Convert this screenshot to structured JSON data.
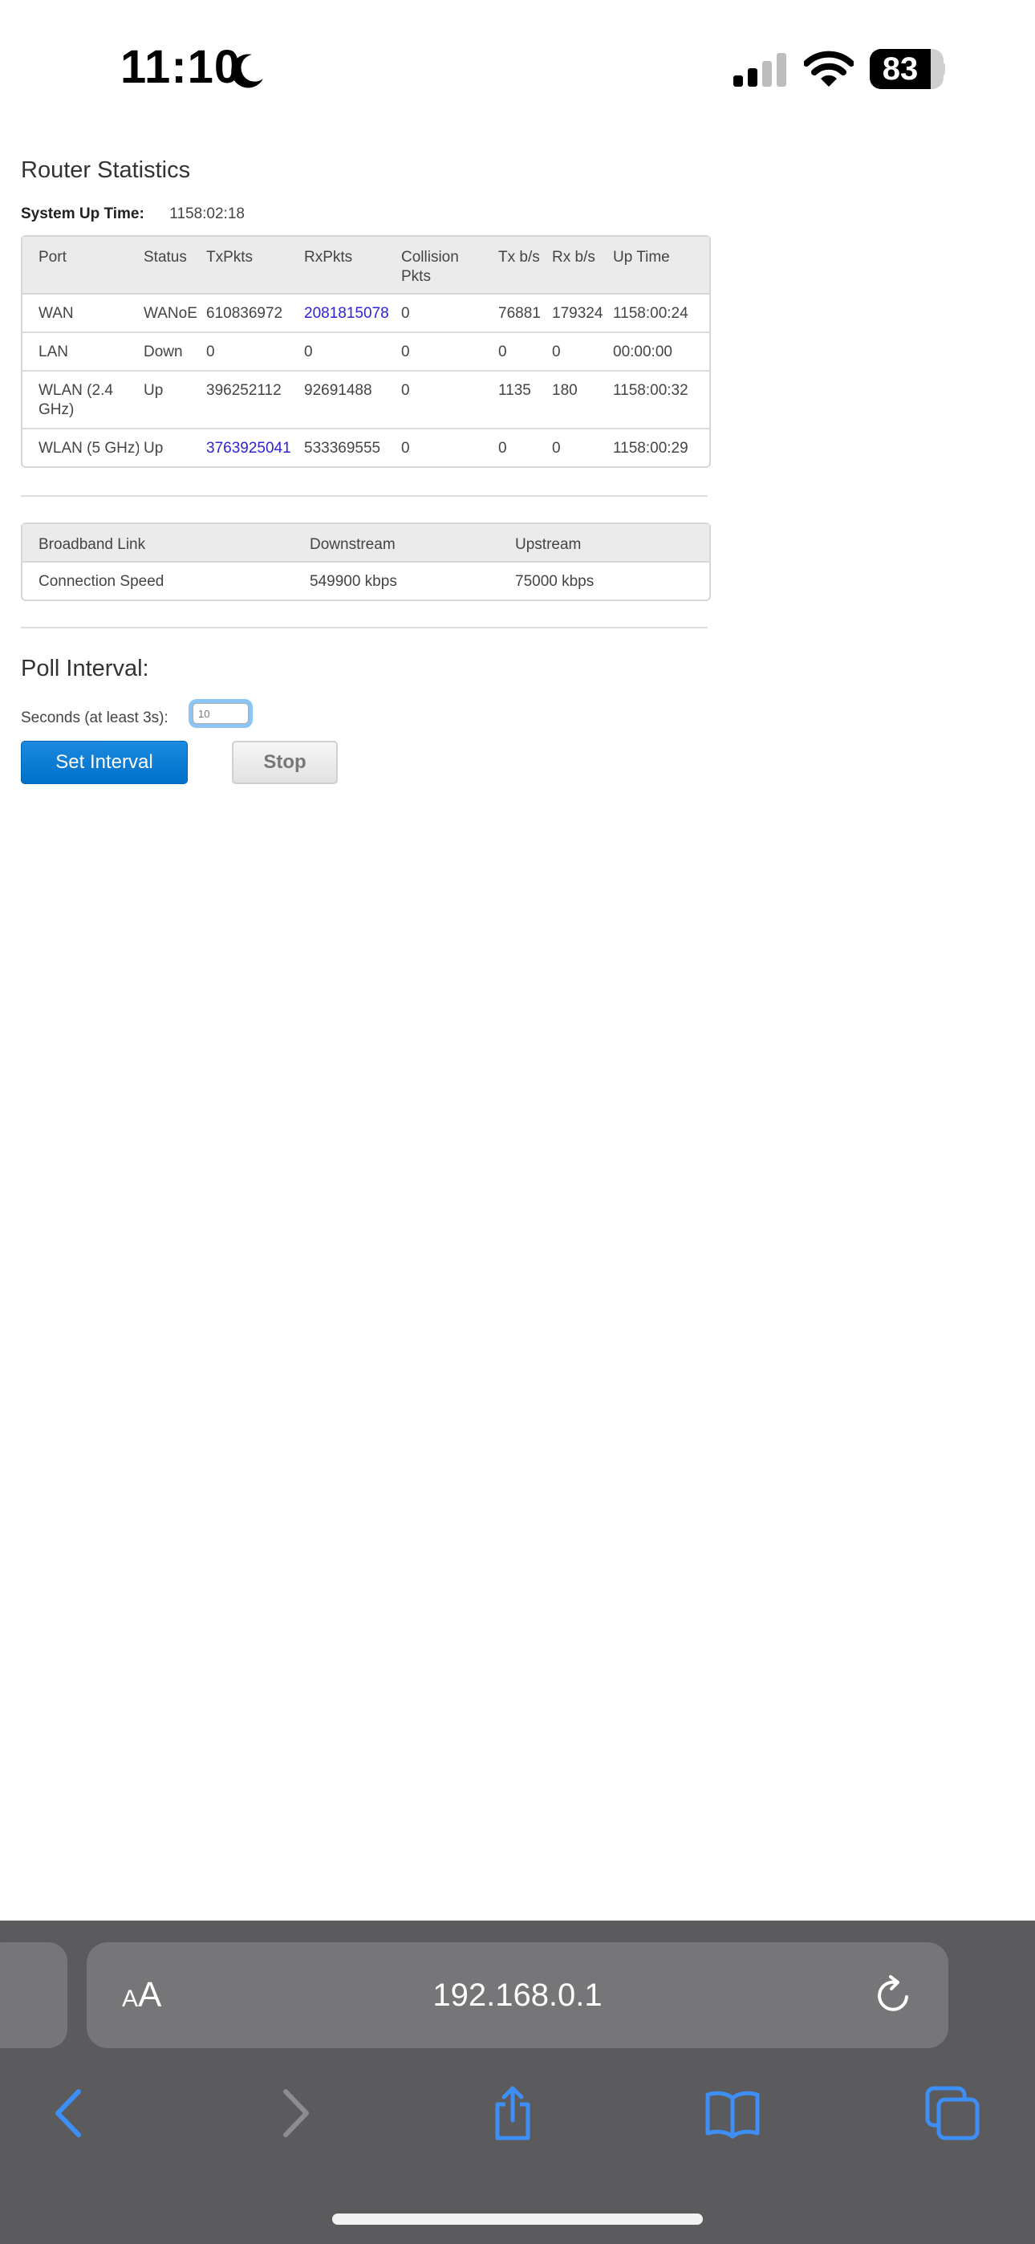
{
  "status_bar": {
    "time": "11:10",
    "battery": "83",
    "battery_level": 0.83
  },
  "router_stats": {
    "title": "Router Statistics",
    "uptime_label": "System Up Time:",
    "uptime_value": "1158:02:18",
    "columns": [
      "Port",
      "Status",
      "TxPkts",
      "RxPkts",
      "Collision Pkts",
      "Tx b/s",
      "Rx b/s",
      "Up Time"
    ],
    "rows": [
      {
        "port": "WAN",
        "status": "WANoE",
        "tx_pkts": "610836972",
        "rx_pkts": "2081815078",
        "collision": "0",
        "tx_bps": "76881",
        "rx_bps": "179324",
        "up_time": "1158:00:24"
      },
      {
        "port": "LAN",
        "status": "Down",
        "tx_pkts": "0",
        "rx_pkts": "0",
        "collision": "0",
        "tx_bps": "0",
        "rx_bps": "0",
        "up_time": "00:00:00"
      },
      {
        "port": "WLAN (2.4 GHz)",
        "status": "Up",
        "tx_pkts": "396252112",
        "rx_pkts": "92691488",
        "collision": "0",
        "tx_bps": "1135",
        "rx_bps": "180",
        "up_time": "1158:00:32"
      },
      {
        "port": "WLAN (5 GHz)",
        "status": "Up",
        "tx_pkts": "3763925041",
        "rx_pkts": "533369555",
        "collision": "0",
        "tx_bps": "0",
        "rx_bps": "0",
        "up_time": "1158:00:29"
      }
    ]
  },
  "broadband": {
    "columns": [
      "Broadband Link",
      "Downstream",
      "Upstream"
    ],
    "rows": [
      {
        "link": "Connection Speed",
        "downstream": "549900 kbps",
        "upstream": "75000 kbps"
      }
    ]
  },
  "poll": {
    "title": "Poll Interval:",
    "seconds_label": "Seconds (at least 3s):",
    "seconds_placeholder": "10",
    "set_button": "Set Interval",
    "stop_button": "Stop"
  },
  "safari": {
    "aa_small": "A",
    "aa_big": "A",
    "url": "192.168.0.1"
  },
  "icons": {
    "moon": "moon-icon",
    "signal": "signal-icon",
    "wifi": "wifi-icon",
    "reload": "reload-icon",
    "back": "chevron-left-icon",
    "forward": "chevron-right-icon",
    "share": "share-icon",
    "bookmarks": "book-icon",
    "tabs": "tabs-icon"
  },
  "colors": {
    "link_blue": "#2f22d6",
    "button_blue": "#0070c9",
    "ios_blue": "#3d8ef5",
    "toolbar_gray": "#5b5b5d"
  }
}
